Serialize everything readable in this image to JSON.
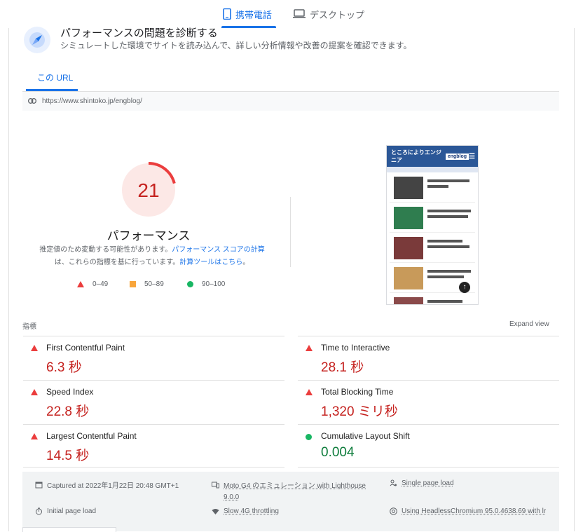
{
  "tabs": [
    {
      "label": "携帯電話",
      "icon": "smartphone-icon",
      "active": true
    },
    {
      "label": "デスクトップ",
      "icon": "laptop-icon",
      "active": false
    }
  ],
  "diagnose": {
    "title": "パフォーマンスの問題を診断する",
    "subtitle": "シミュレートした環境でサイトを読み込んで、詳しい分析情報や改善の提案を確認できます。"
  },
  "url_tab": "この URL",
  "url": "https://www.shintoko.jp/engblog/",
  "performance": {
    "score": "21",
    "score_fraction": 0.21,
    "label": "パフォーマンス",
    "desc_1": "推定値のため変動する可能性があります。",
    "desc_link_1": "パフォーマンス スコアの計算",
    "desc_2": "は、これらの指標を基に行っています。",
    "desc_link_2": "計算ツールはこちら",
    "desc_3": "。",
    "legend": [
      {
        "range": "0–49",
        "color": "#eb3d3d"
      },
      {
        "range": "50–89",
        "color": "#f8a53b"
      },
      {
        "range": "90–100",
        "color": "#18b663"
      }
    ]
  },
  "thumbnail": {
    "site_title": "ところによりエンジニア",
    "site_logo": "engblog"
  },
  "metrics": {
    "section_label": "指標",
    "expand_label": "Expand view",
    "items": [
      {
        "name": "First Contentful Paint",
        "value": "6.3 秒",
        "status": "fail"
      },
      {
        "name": "Time to Interactive",
        "value": "28.1 秒",
        "status": "fail"
      },
      {
        "name": "Speed Index",
        "value": "22.8 秒",
        "status": "fail"
      },
      {
        "name": "Total Blocking Time",
        "value": "1,320 ミリ秒",
        "status": "fail"
      },
      {
        "name": "Largest Contentful Paint",
        "value": "14.5 秒",
        "status": "fail"
      },
      {
        "name": "Cumulative Layout Shift",
        "value": "0.004",
        "status": "pass"
      }
    ]
  },
  "run_info": {
    "captured": "Captured at 2022年1月22日 20:48 GMT+1",
    "device": "Moto G4 のエミュレーション with Lighthouse",
    "lighthouse_version": "9.0.0",
    "session": "Single page load",
    "page_load": "Initial page load",
    "throttling": "Slow 4G throttling",
    "browser": "Using HeadlessChromium 95.0.4638.69 with lr"
  }
}
